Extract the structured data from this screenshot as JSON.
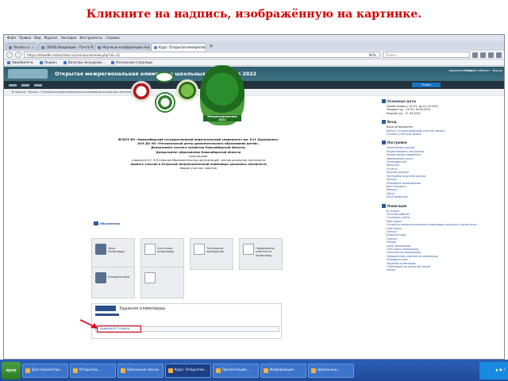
{
  "slide_title": "Кликните на надпись, изображённую на картинке.",
  "browser": {
    "menu": [
      "Файл",
      "Правка",
      "Вид",
      "Журнал",
      "Закладки",
      "Инструменты",
      "Справка"
    ],
    "tabs": [
      {
        "label": "Yandex.ru",
        "active": false
      },
      {
        "label": "(5048) Входящие - Почта M...",
        "active": false
      },
      {
        "label": "Научные конференции Новос...",
        "active": false
      },
      {
        "label": "Курс: Открытая межрегиональ...",
        "active": true
      }
    ],
    "url": "https://moodle.mskocfresv.ru/cs/course/view.php?id=11",
    "zoom": "90%",
    "search_placeholder": "Поиск",
    "bookmarks": [
      "Авиабилеты",
      "Яндекс",
      "Вологда экскурсии...",
      "Начальная страница"
    ]
  },
  "site": {
    "title": "Открытая межрегиональная олимпиада школьных лесничеств 2022",
    "user": "Администратор",
    "user_links": "Личный кабинет · Выход",
    "edit_button": "Режим редактирования",
    "breadcrumb": "В начало › Курсы › Открытая межрегиональная олимпиада школьных лесничеств",
    "tree_label": "Межрегиональная 2022",
    "text_lines": [
      "ФГБОУ ВО «Новосибирский государственный педагогический университет им. Н.Н. Дорошенко»",
      "АОУ ДО НО «Региональный центр дополнительного образования детей»,",
      "Департамент лесного хозяйства Новосибирской области,",
      "Департамент образования Новосибирской области",
      "приглашают",
      "учащихся 6-7, 8-9 классов образовательных организаций, членов школьных лесничеств",
      "принять участие в Открытой межрегиональной олимпиаде школьных лесничеств",
      "Форма участия: заочная"
    ],
    "announcement": "Объявления",
    "tiles": [
      {
        "label": "Цель олимпиады",
        "icon": "target-icon"
      },
      {
        "label": "Участники олимпиады",
        "icon": "participants-icon"
      },
      {
        "label": "Технология проведения",
        "icon": "process-icon"
      },
      {
        "label": "Оформление ответов на олимпиаду",
        "icon": "edit-icon"
      },
      {
        "label": "Координаторы",
        "icon": "coordinators-icon"
      },
      {
        "label": "",
        "icon": "document-icon"
      }
    ],
    "tasks_title": "Задания олимпиады",
    "task_highlight": "Задания 6-7 класса",
    "sidebar": {
      "dates": {
        "title": "Основные даты",
        "lines": [
          "Приём заявок с 01.02. до 01.03.2022",
          "Первый тур - 14.03.-18.03.2022",
          "Второй тур - 17.03.2022"
        ]
      },
      "login": {
        "title": "Вход",
        "lines": [
          "Вход не выполнен",
          "Войти с использованием учетной записи",
          "Создать учетную запись"
        ]
      },
      "settings": {
        "title": "Настройки",
        "lines": [
          "Управление курсом",
          "Редактировать настройки",
          "Режим редактирования",
          "Завершение курса",
          "Пользователи",
          "Фильтры",
          "Отчёты",
          "Журнал оценок",
          "Настройки журнала оценок",
          "Значки",
          "Резервное копирование",
          "Восстановить",
          "Импорт",
          "Сброс",
          "Банк вопросов"
        ]
      },
      "navigation": {
        "title": "Навигация",
        "lines": [
          "В начало",
          "Личный кабинет",
          "Страницы сайта",
          "Мои курсы",
          "Открытая межрегиональная олимпиада школьных лесничеств",
          "Участники",
          "Значки",
          "Компетенции",
          "Оценки",
          "Общее",
          "Цель олимпиады",
          "Участники олимпиады",
          "Технология проведения",
          "Оформление ответов на олимпиаду",
          "Координаторы",
          "Задания олимпиады",
          "Олимпиада по экологии лесов",
          "Курсы"
        ]
      }
    }
  },
  "taskbar": {
    "start": "пуск",
    "items": [
      "Для просмотра...",
      "Открытка...",
      "Школьные лесни...",
      "Курс: Открытая...",
      "Презентация...",
      "Информация...",
      "Школьные..."
    ],
    "active_index": 3
  }
}
